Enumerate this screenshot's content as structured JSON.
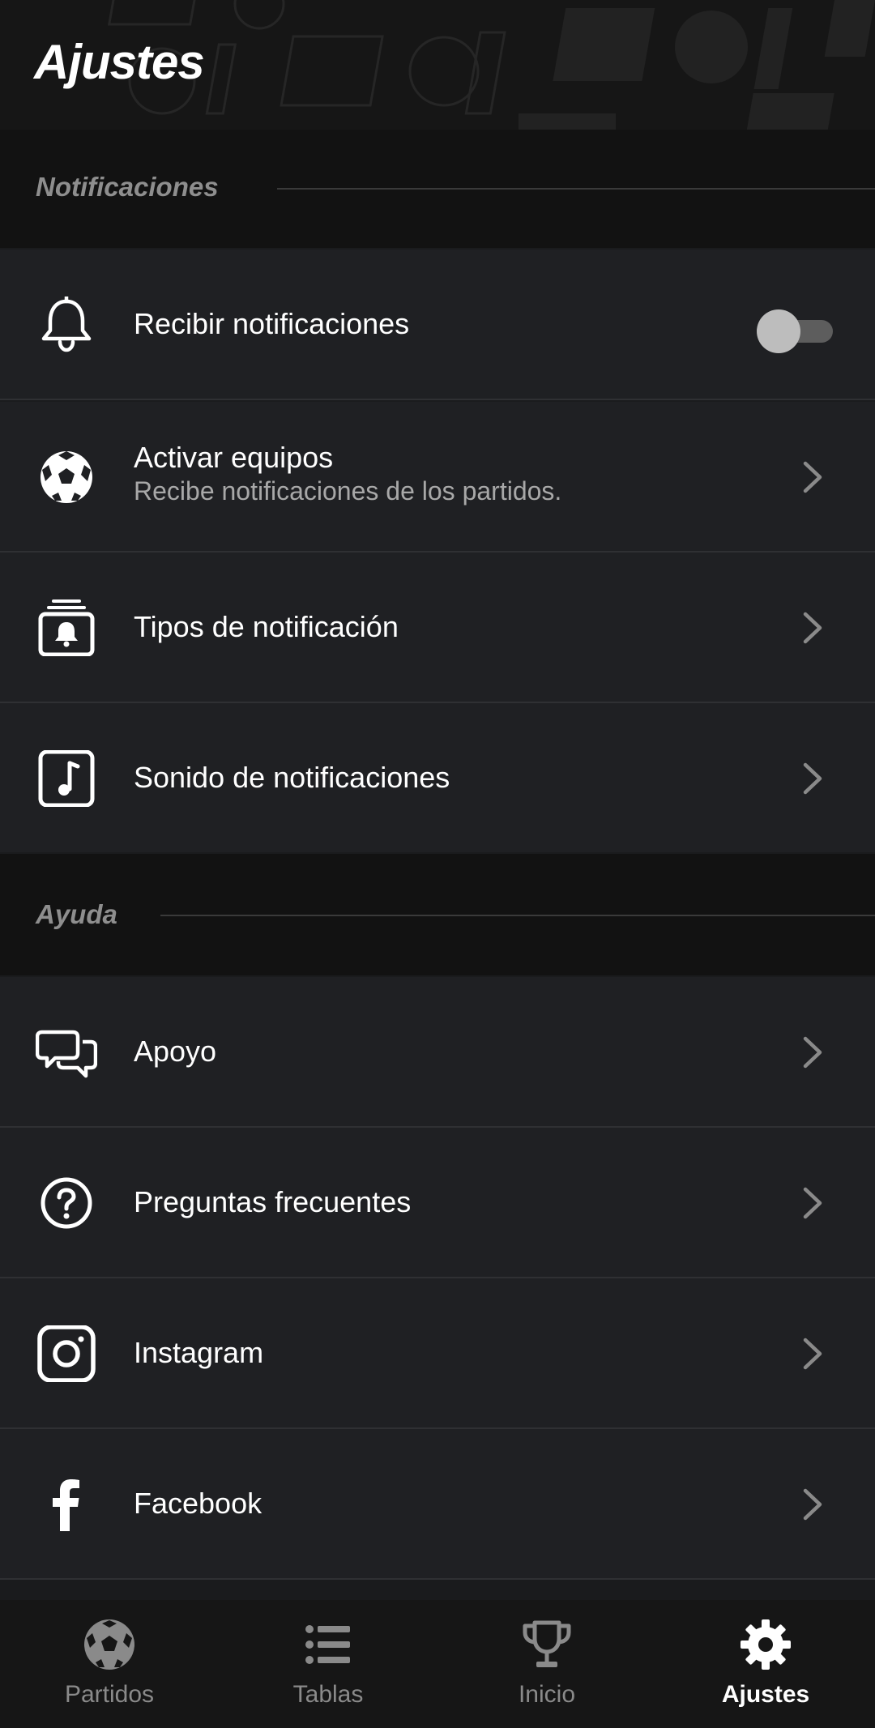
{
  "header": {
    "title": "Ajustes"
  },
  "sections": {
    "notifications": {
      "title": "Notificaciones",
      "items": [
        {
          "label": "Recibir notificaciones",
          "icon": "bell-icon",
          "control": "toggle",
          "toggle_on": false
        },
        {
          "label": "Activar equipos",
          "sublabel": "Recibe notificaciones de los partidos.",
          "icon": "soccer-ball-icon",
          "control": "chevron"
        },
        {
          "label": "Tipos de notificación",
          "icon": "notification-types-icon",
          "control": "chevron"
        },
        {
          "label": "Sonido de notificaciones",
          "icon": "music-note-icon",
          "control": "chevron"
        }
      ]
    },
    "help": {
      "title": "Ayuda",
      "items": [
        {
          "label": "Apoyo",
          "icon": "chat-bubbles-icon",
          "control": "chevron"
        },
        {
          "label": "Preguntas frecuentes",
          "icon": "question-circle-icon",
          "control": "chevron"
        },
        {
          "label": "Instagram",
          "icon": "instagram-icon",
          "control": "chevron"
        },
        {
          "label": "Facebook",
          "icon": "facebook-icon",
          "control": "chevron"
        }
      ]
    }
  },
  "bottom_nav": {
    "items": [
      {
        "label": "Partidos",
        "icon": "soccer-ball-icon",
        "active": false
      },
      {
        "label": "Tablas",
        "icon": "list-icon",
        "active": false
      },
      {
        "label": "Inicio",
        "icon": "trophy-icon",
        "active": false
      },
      {
        "label": "Ajustes",
        "icon": "gear-icon",
        "active": true
      }
    ]
  },
  "colors": {
    "background": "#1a1b1d",
    "row_background": "#1f2023",
    "section_background": "#121212",
    "nav_background": "#161616",
    "text_primary": "#ffffff",
    "text_secondary": "#a8a8a8",
    "text_muted": "#8e8e8e",
    "nav_inactive": "#8a8a8a"
  }
}
